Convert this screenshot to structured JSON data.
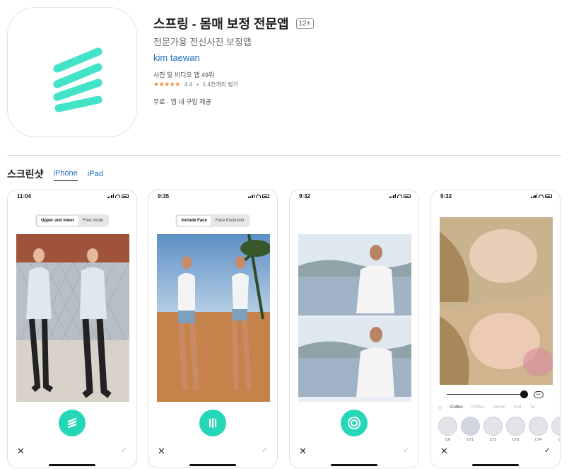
{
  "app": {
    "title": "스프링 - 몸매 보정 전문앱",
    "age_rating": "12+",
    "subtitle": "전문가용 전신사진 보정앱",
    "developer": "kim taewan",
    "rank": "사진 및 비디오 앱 49위",
    "stars": "★★★★★",
    "rating": "4.4",
    "rating_count": "1.4천개의 평가",
    "price": "무료 · 앱 내 구입 제공",
    "icon": "spring-logo-icon",
    "accent_color": "#25d7b6",
    "link_color": "#1f6fbf"
  },
  "screenshots": {
    "title": "스크린샷",
    "tabs": [
      {
        "label": "iPhone",
        "active": true
      },
      {
        "label": "iPad",
        "active": false
      }
    ],
    "phones": [
      {
        "time": "11:04",
        "segment": [
          "Upper and lower",
          "Free mode"
        ],
        "button_icon": "spring-icon"
      },
      {
        "time": "9:35",
        "segment": [
          "Include Face",
          "Face Exclusion"
        ],
        "button_icon": "split-bars-icon"
      },
      {
        "time": "9:32",
        "button_icon": "target-icon"
      },
      {
        "time": "9:32",
        "fx_label": "Fx",
        "filters": [
          "Cotton",
          "Chiffon",
          "Denim",
          "Knit",
          "Tw"
        ],
        "thumb_labels": [
          "CH",
          "CT1",
          "CT2",
          "CT3",
          "CT4",
          "CT"
        ]
      }
    ],
    "close_glyph": "✕",
    "check_glyph": "✓"
  }
}
